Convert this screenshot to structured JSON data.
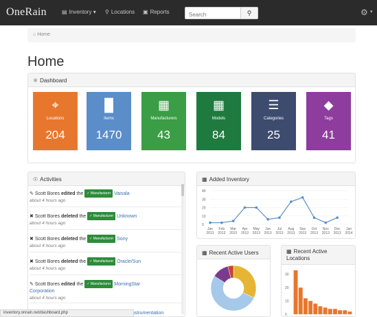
{
  "navbar": {
    "brand": "OneRain",
    "inventory": "Inventory",
    "locations": "Locations",
    "reports": "Reports",
    "search_placeholder": "Search"
  },
  "breadcrumb": {
    "home": "Home"
  },
  "page": {
    "title": "Home"
  },
  "dashboard": {
    "title": "Dashboard",
    "tiles": [
      {
        "label": "Locations",
        "value": "204",
        "icon": "map-marker-icon",
        "color": "#e8772e"
      },
      {
        "label": "Items",
        "value": "1470",
        "icon": "barcode-icon",
        "color": "#5b8dc9"
      },
      {
        "label": "Manufacturers",
        "value": "43",
        "icon": "building-icon",
        "color": "#3b9d46"
      },
      {
        "label": "Models",
        "value": "84",
        "icon": "grid-icon",
        "color": "#1f7a3f"
      },
      {
        "label": "Categories",
        "value": "25",
        "icon": "list-icon",
        "color": "#3d4b6e"
      },
      {
        "label": "Tags",
        "value": "41",
        "icon": "tags-icon",
        "color": "#8e3c9e"
      }
    ]
  },
  "activities": {
    "title": "Activities",
    "items": [
      {
        "user": "Scott Bores",
        "action": "edited",
        "the": "the",
        "badge": "Manufacturer",
        "target": "Vaisala",
        "time": "about 4 hours ago"
      },
      {
        "user": "Scott Bores",
        "action": "deleted",
        "the": "the",
        "badge": "Manufacturer",
        "target": "Unknown",
        "time": "about 4 hours ago"
      },
      {
        "user": "Scott Bores",
        "action": "deleted",
        "the": "the",
        "badge": "Manufacturer",
        "target": "Sony",
        "time": "about 4 hours ago"
      },
      {
        "user": "Scott Bores",
        "action": "deleted",
        "the": "the",
        "badge": "Manufacturer",
        "target": "Oracle/Sun",
        "time": "about 4 hours ago"
      },
      {
        "user": "Scott Bores",
        "action": "edited",
        "the": "the",
        "badge": "Manufacturer",
        "target": "MorningStar",
        "target_line2": "Corporation",
        "time": "about 4 hours ago"
      }
    ],
    "partial_link": "Instrumentation"
  },
  "status_url": "inventory.onrain.net/dashboard.php",
  "added_inventory": {
    "title": "Added Inventory"
  },
  "recent_users": {
    "title": "Recent Active Users"
  },
  "recent_locations": {
    "title_line1": "Recent Active",
    "title_line2": "Locations"
  },
  "chart_data": [
    {
      "type": "line",
      "title": "Added Inventory",
      "categories": [
        "Jan 2013",
        "Feb 2013",
        "Mar 2013",
        "Apr 2013",
        "May 2013",
        "Jun 2013",
        "Jul 2013",
        "Aug 2013",
        "Sep 2013",
        "Oct 2013",
        "Nov 2013",
        "Dec 2013",
        "Jan 2014"
      ],
      "tick_labels": [
        [
          "Jan",
          "2013"
        ],
        [
          "Feb",
          "2013"
        ],
        [
          "Mar",
          "2013"
        ],
        [
          "Apr",
          "2013"
        ],
        [
          "May",
          "2013"
        ],
        [
          "Jun",
          "2013"
        ],
        [
          "Jul",
          "2013"
        ],
        [
          "Aug",
          "2013"
        ],
        [
          "Sep",
          "2013"
        ],
        [
          "Oct",
          "2013"
        ],
        [
          "Nov",
          "2013"
        ],
        [
          "Dec",
          "2013"
        ],
        [
          "Jan",
          "2014"
        ]
      ],
      "values": [
        2,
        2,
        4,
        20,
        20,
        6,
        8,
        27,
        32,
        8,
        2,
        8
      ],
      "yticks": [
        0,
        10,
        20,
        30,
        40
      ],
      "ylim": [
        0,
        40
      ],
      "color": "#5b8dc9"
    },
    {
      "type": "pie",
      "title": "Recent Active Users",
      "slices": [
        {
          "value": 32,
          "color": "#e6b534"
        },
        {
          "value": 52,
          "color": "#a6c9ea"
        },
        {
          "value": 12,
          "color": "#7a3b8f"
        },
        {
          "value": 4,
          "color": "#c9442f"
        }
      ]
    },
    {
      "type": "bar",
      "title": "Recent Active Locations",
      "values": [
        33,
        20,
        12,
        10,
        8,
        6,
        5,
        4,
        4,
        3,
        3,
        2
      ],
      "yticks": [
        0,
        10,
        20,
        30
      ],
      "ylim": [
        0,
        35
      ],
      "color": "#e8772e"
    }
  ]
}
